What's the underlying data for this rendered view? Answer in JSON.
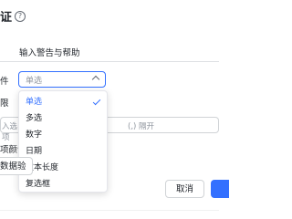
{
  "dialog": {
    "title": "证",
    "help_icon": "question-circle-icon",
    "tab_label": "输入警告与帮助"
  },
  "form": {
    "field_label_1": "件",
    "field_label_2": "限",
    "field_label_3": "项颜色",
    "select_value": "单选",
    "input_placeholder_left": "入选项",
    "input_placeholder_right": "(,) 隔开"
  },
  "dropdown": {
    "options": [
      "单选",
      "多选",
      "数字",
      "日期",
      "文本长度",
      "复选框"
    ],
    "selected": "单选"
  },
  "buttons": {
    "left_partial": "数据验",
    "cancel": "取消"
  },
  "colors": {
    "accent": "#3370ff",
    "border": "#d0d3d6",
    "text": "#1f2329",
    "placeholder": "#8f959e"
  }
}
